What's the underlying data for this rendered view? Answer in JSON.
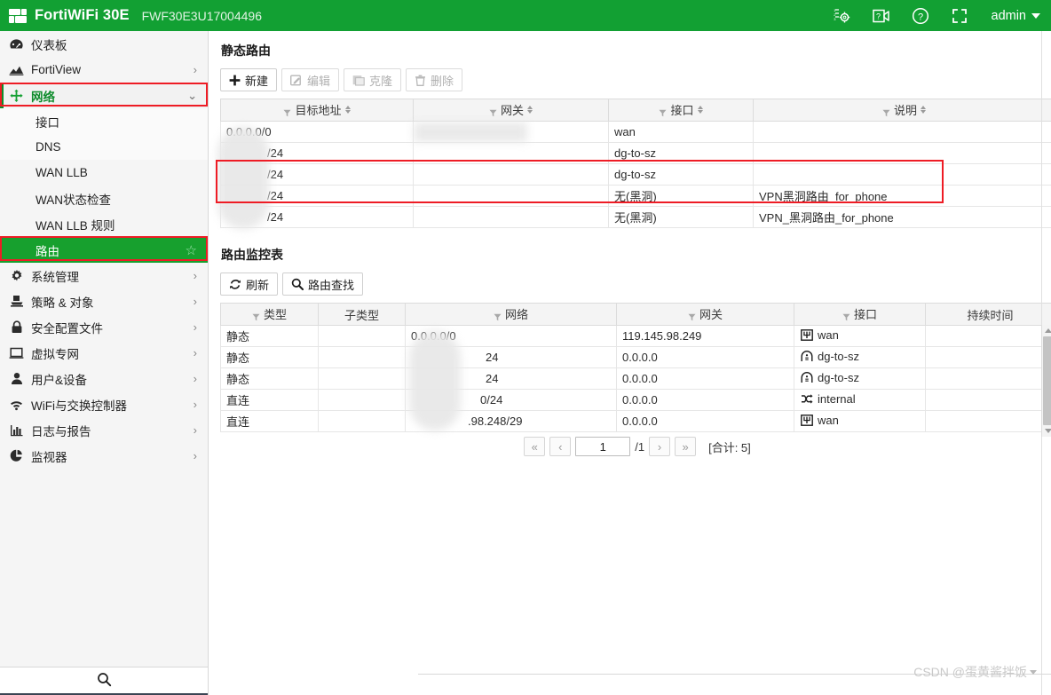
{
  "header": {
    "brand": "FortiWiFi 30E",
    "serial": "FWF30E3U17004496",
    "icons": [
      "settings-gear-icon",
      "video-help-icon",
      "help-question-icon",
      "fullscreen-icon"
    ],
    "admin_label": "admin"
  },
  "sidebar": {
    "items": [
      {
        "label": "仪表板",
        "icon": "dashboard-icon",
        "level": 0,
        "chevron": "",
        "state": "normal"
      },
      {
        "label": "FortiView",
        "icon": "fortiview-icon",
        "level": 0,
        "chevron": "›",
        "state": "normal"
      },
      {
        "label": "网络",
        "icon": "network-move-icon",
        "level": 0,
        "chevron": "⌄",
        "state": "expanded"
      },
      {
        "label": "接口",
        "icon": "",
        "level": 1,
        "chevron": "",
        "state": "sub"
      },
      {
        "label": "DNS",
        "icon": "",
        "level": 1,
        "chevron": "",
        "state": "sub"
      },
      {
        "label": "WAN LLB",
        "icon": "",
        "level": 1,
        "chevron": "",
        "state": "sub2"
      },
      {
        "label": "WAN状态检查",
        "icon": "",
        "level": 1,
        "chevron": "",
        "state": "sub2"
      },
      {
        "label": "WAN LLB 规则",
        "icon": "",
        "level": 1,
        "chevron": "",
        "state": "sub2"
      },
      {
        "label": "路由",
        "icon": "",
        "level": 1,
        "chevron": "",
        "state": "active"
      },
      {
        "label": "系统管理",
        "icon": "gear-icon",
        "level": 0,
        "chevron": "›",
        "state": "normal"
      },
      {
        "label": "策略 & 对象",
        "icon": "policy-icon",
        "level": 0,
        "chevron": "›",
        "state": "normal"
      },
      {
        "label": "安全配置文件",
        "icon": "lock-icon",
        "level": 0,
        "chevron": "›",
        "state": "normal"
      },
      {
        "label": "虚拟专网",
        "icon": "vpn-monitor-icon",
        "level": 0,
        "chevron": "›",
        "state": "normal"
      },
      {
        "label": "用户&设备",
        "icon": "user-icon",
        "level": 0,
        "chevron": "›",
        "state": "normal"
      },
      {
        "label": "WiFi与交换控制器",
        "icon": "wifi-icon",
        "level": 0,
        "chevron": "›",
        "state": "normal"
      },
      {
        "label": "日志与报告",
        "icon": "chart-bar-icon",
        "level": 0,
        "chevron": "›",
        "state": "normal"
      },
      {
        "label": "监视器",
        "icon": "pie-chart-icon",
        "level": 0,
        "chevron": "›",
        "state": "normal"
      }
    ],
    "favorite_star": "☆",
    "search_icon": "search-icon"
  },
  "static_route": {
    "title": "静态路由",
    "toolbar": [
      {
        "label": "新建",
        "icon": "plus-icon",
        "enabled": true
      },
      {
        "label": "编辑",
        "icon": "edit-icon",
        "enabled": false
      },
      {
        "label": "克隆",
        "icon": "clone-icon",
        "enabled": false
      },
      {
        "label": "删除",
        "icon": "trash-icon",
        "enabled": false
      }
    ],
    "columns": [
      "目标地址",
      "网关",
      "接口",
      "说明"
    ],
    "rows": [
      {
        "dest": "0.0.0.0/0",
        "gateway": "",
        "iface": "wan",
        "desc": ""
      },
      {
        "dest": "/24",
        "gateway": "",
        "iface": "dg-to-sz",
        "desc": ""
      },
      {
        "dest": "/24",
        "gateway": "",
        "iface": "dg-to-sz",
        "desc": ""
      },
      {
        "dest": "/24",
        "gateway": "",
        "iface": "无(黑洞)",
        "desc": "VPN黑洞路由_for_phone"
      },
      {
        "dest": "/24",
        "gateway": "",
        "iface": "无(黑洞)",
        "desc": "VPN_黑洞路由_for_phone"
      }
    ]
  },
  "route_monitor": {
    "title": "路由监控表",
    "toolbar": [
      {
        "label": "刷新",
        "icon": "refresh-icon"
      },
      {
        "label": "路由查找",
        "icon": "search-icon"
      }
    ],
    "columns": [
      "类型",
      "子类型",
      "网络",
      "网关",
      "接口",
      "持续时间"
    ],
    "rows": [
      {
        "type": "静态",
        "subtype": "",
        "network": "0.0.0.0/0",
        "gateway": "119.145.98.249",
        "iface": "wan",
        "iface_icon": "wan-port-icon",
        "duration": ""
      },
      {
        "type": "静态",
        "subtype": "",
        "network": "24",
        "gateway": "0.0.0.0",
        "iface": "dg-to-sz",
        "iface_icon": "tunnel-icon",
        "duration": ""
      },
      {
        "type": "静态",
        "subtype": "",
        "network": "24",
        "gateway": "0.0.0.0",
        "iface": "dg-to-sz",
        "iface_icon": "tunnel-icon",
        "duration": ""
      },
      {
        "type": "直连",
        "subtype": "",
        "network": "0/24",
        "gateway": "0.0.0.0",
        "iface": "internal",
        "iface_icon": "switch-icon",
        "duration": ""
      },
      {
        "type": "直连",
        "subtype": "",
        "network": ".98.248/29",
        "gateway": "0.0.0.0",
        "iface": "wan",
        "iface_icon": "wan-port-icon",
        "duration": ""
      }
    ],
    "pager": {
      "first": "«",
      "prev": "‹",
      "page_value": "1",
      "page_total": "/1",
      "next": "›",
      "last": "»",
      "count_label": "[合计: 5]"
    }
  },
  "watermark": {
    "text": "CSDN @蛋黄酱拌饭"
  },
  "colors": {
    "brand_green": "#12a033",
    "active_green": "#17a02e",
    "highlight_red": "#ee1c25"
  }
}
